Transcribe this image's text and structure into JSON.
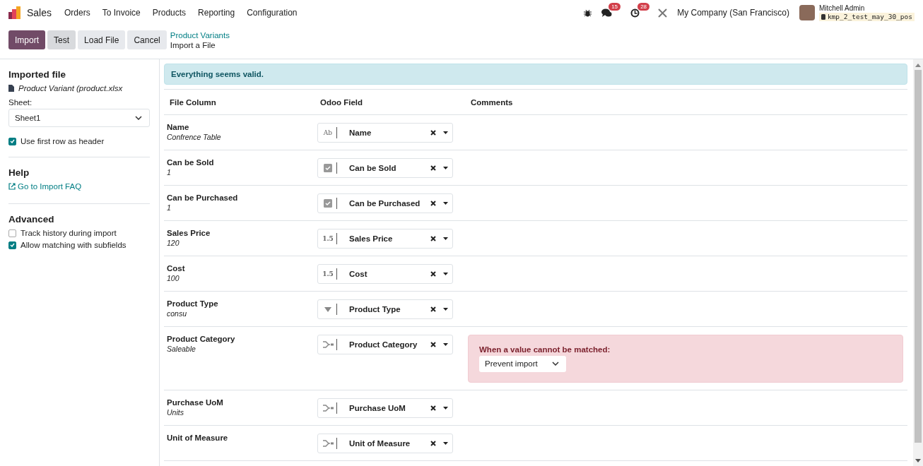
{
  "navbar": {
    "app_name": "Sales",
    "menu": [
      "Orders",
      "To Invoice",
      "Products",
      "Reporting",
      "Configuration"
    ],
    "messages_count": "15",
    "activities_count": "28",
    "company": "My Company (San Francisco)",
    "user_name": "Mitchell Admin",
    "database": "kmp_2_test_may_30_pos"
  },
  "control_panel": {
    "buttons": [
      {
        "label": "Import",
        "kind": "primary"
      },
      {
        "label": "Test",
        "kind": "secondary"
      },
      {
        "label": "Load File",
        "kind": "light"
      },
      {
        "label": "Cancel",
        "kind": "light"
      }
    ],
    "breadcrumb": "Product Variants",
    "title": "Import a File"
  },
  "sidebar": {
    "imported_file": {
      "heading": "Imported file",
      "file_name": "Product Variant (product.xlsx",
      "sheet_label": "Sheet:",
      "sheet_value": "Sheet1",
      "options": [
        {
          "label": "Use first row as header",
          "checked": true
        }
      ]
    },
    "help": {
      "heading": "Help",
      "link": "Go to Import FAQ"
    },
    "advanced": {
      "heading": "Advanced",
      "options": [
        {
          "label": "Track history during import",
          "checked": false
        },
        {
          "label": "Allow matching with subfields",
          "checked": true
        }
      ]
    }
  },
  "alert": "Everything seems valid.",
  "table": {
    "columns": [
      "File Column",
      "Odoo Field",
      "Comments"
    ],
    "rows": [
      {
        "column": "Name",
        "sample": "Confrence Table",
        "field": "Name",
        "kind": "text",
        "type_icon": "Ab"
      },
      {
        "column": "Can be Sold",
        "sample": "1",
        "field": "Can be Sold",
        "kind": "boolean"
      },
      {
        "column": "Can be Purchased",
        "sample": "1",
        "field": "Can be Purchased",
        "kind": "boolean"
      },
      {
        "column": "Sales Price",
        "sample": "120",
        "field": "Sales Price",
        "kind": "float",
        "type_icon": "1.5"
      },
      {
        "column": "Cost",
        "sample": "100",
        "field": "Cost",
        "kind": "float",
        "type_icon": "1.5"
      },
      {
        "column": "Product Type",
        "sample": "consu",
        "field": "Product Type",
        "kind": "selection"
      },
      {
        "column": "Product Category",
        "sample": "Saleable",
        "field": "Product Category",
        "kind": "relation",
        "comment": {
          "label": "When a value cannot be matched:",
          "value": "Prevent import"
        }
      },
      {
        "column": "Purchase UoM",
        "sample": "Units",
        "field": "Purchase UoM",
        "kind": "relation"
      },
      {
        "column": "Unit of Measure",
        "field": "Unit of Measure",
        "kind": "relation"
      }
    ]
  }
}
